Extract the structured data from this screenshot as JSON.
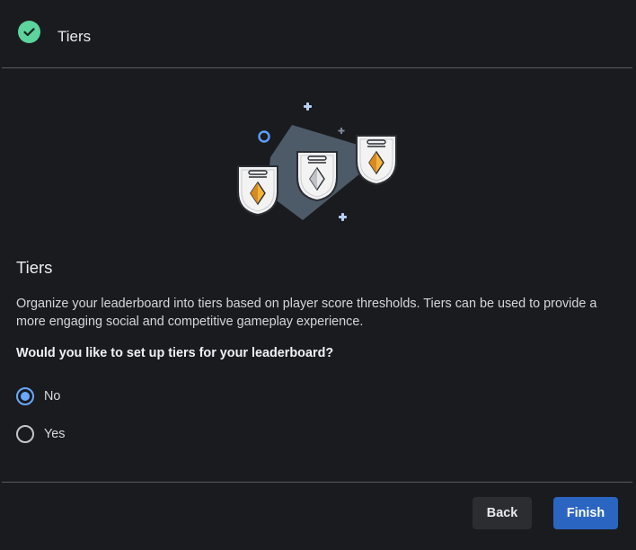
{
  "colors": {
    "success": "#5dd39e",
    "accent": "#6aa8ff",
    "primary_button": "#2b65c2",
    "secondary_button": "#2b2d31"
  },
  "header": {
    "title": "Tiers",
    "status_icon": "check-circle-icon"
  },
  "illustration": {
    "icon": "tier-shields-illustration"
  },
  "section": {
    "title": "Tiers",
    "description": "Organize your leaderboard into tiers based on player score thresholds. Tiers can be used to provide a more engaging social and competitive gameplay experience.",
    "question": "Would you like to set up tiers for your leaderboard?"
  },
  "options": [
    {
      "label": "No",
      "selected": true
    },
    {
      "label": "Yes",
      "selected": false
    }
  ],
  "footer": {
    "back_label": "Back",
    "finish_label": "Finish"
  }
}
